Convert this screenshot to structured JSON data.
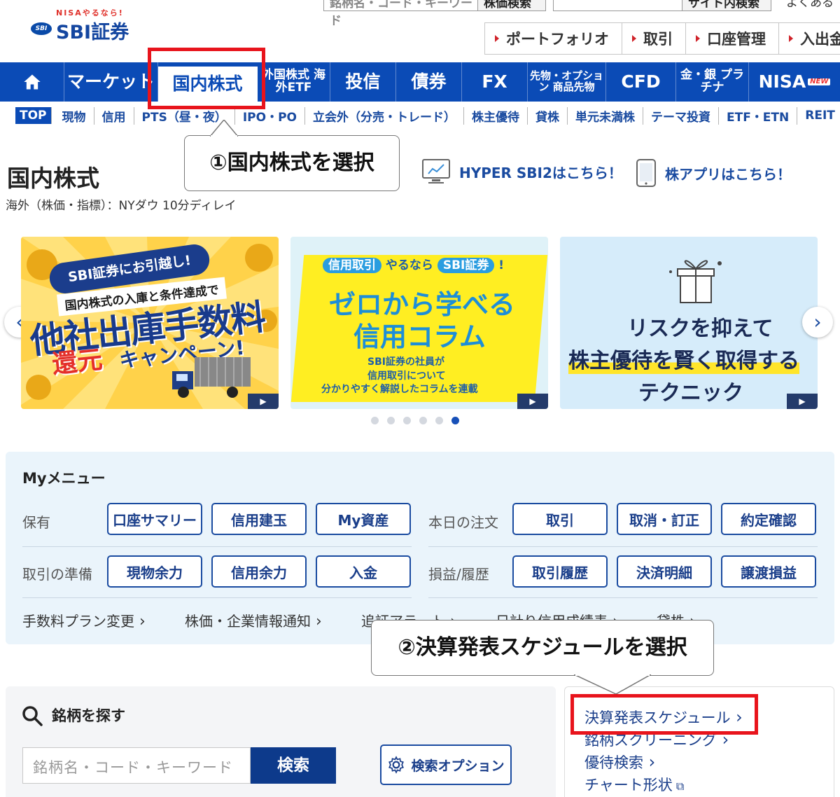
{
  "header": {
    "search_placeholder": "銘柄名・コード・キーワード",
    "search_button": "株価検索",
    "site_search_button": "サイト内検索",
    "faq_link": "よくある",
    "logo_tagline": "NISAやるなら!",
    "logo_name": "SBI証券",
    "logo_mark": "SBI",
    "quick_links": [
      "ポートフォリオ",
      "取引",
      "口座管理",
      "入出金"
    ]
  },
  "global_nav": {
    "home_label": "",
    "items": [
      {
        "label": "マーケット"
      },
      {
        "label": "国内株式"
      },
      {
        "label": "外国株式 海外ETF"
      },
      {
        "label": "投信"
      },
      {
        "label": "債券"
      },
      {
        "label": "FX"
      },
      {
        "label": "先物・オプション 商品先物"
      },
      {
        "label": "CFD"
      },
      {
        "label": "金・銀 プラチナ"
      },
      {
        "label": "NISA"
      }
    ],
    "new_badge": "NEW"
  },
  "sub_nav": [
    "TOP",
    "現物",
    "信用",
    "PTS（昼・夜）",
    "IPO・PO",
    "立会外（分売・トレード）",
    "株主優待",
    "貸株",
    "単元未満株",
    "テーマ投資",
    "ETF・ETN",
    "REIT"
  ],
  "page": {
    "title": "国内株式",
    "delay_note": "海外（株価・指標）：NYダウ 10分ディレイ",
    "hyper_link": "HYPER SBI2はこちら！",
    "app_link": "株アプリはこちら！"
  },
  "banners": {
    "b1": {
      "ribbon": "SBI証券にお引越し!",
      "line2": "国内株式の入庫と条件達成で",
      "big": "他社出庫手数料",
      "red": "還元",
      "camp": "キャンペーン!"
    },
    "b2": {
      "pill1": "信用取引",
      "mid": "やるなら",
      "pill2": "SBI証券",
      "end": "!",
      "t1": "ゼロから学べる",
      "t2": "信用コラム",
      "d1": "SBI証券の社員が",
      "d2": "信用取引について",
      "d3": "分かりやすく解説したコラムを連載"
    },
    "b3": {
      "l1": "リスクを抑えて",
      "l2": "株主優待を賢く取得する",
      "l3": "テクニック"
    },
    "play": "▶",
    "prev": "‹",
    "next": "›",
    "active_dot": 6,
    "dot_count": 6
  },
  "my_menu": {
    "title": "Myメニュー",
    "rows": [
      {
        "label_left": "保有",
        "left": [
          "口座サマリー",
          "信用建玉",
          "My資産"
        ],
        "label_right": "本日の注文",
        "right": [
          "取引",
          "取消・訂正",
          "約定確認"
        ]
      },
      {
        "label_left": "取引の準備",
        "left": [
          "現物余力",
          "信用余力",
          "入金"
        ],
        "label_right": "損益/履歴",
        "right": [
          "取引履歴",
          "決済明細",
          "譲渡損益"
        ]
      }
    ],
    "links": [
      "手数料プラン変更",
      "株価・企業情報通知",
      "追証アラート",
      "日計り信用成績表",
      "貸株"
    ]
  },
  "callouts": {
    "step1": "①国内株式を選択",
    "step2": "②決算発表スケジュールを選択"
  },
  "stock_search": {
    "title": "銘柄を探す",
    "placeholder": "銘柄名・コード・キーワード",
    "button": "検索",
    "option": "検索オプション"
  },
  "tools": [
    "決算発表スケジュール",
    "銘柄スクリーニング",
    "優待検索",
    "チャート形状"
  ],
  "colors": {
    "brand": "#0b4bb6",
    "highlight": "#e8141c",
    "link": "#1a4ba0"
  }
}
